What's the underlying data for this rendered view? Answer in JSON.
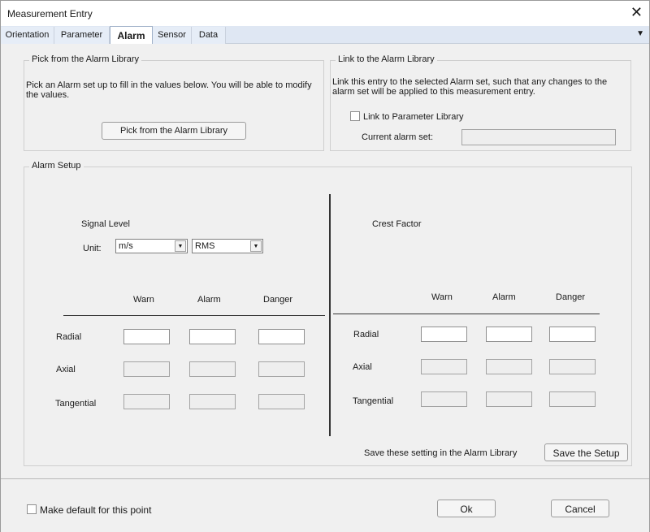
{
  "window": {
    "title": "Measurement Entry"
  },
  "tabs": [
    {
      "label": "Orientation"
    },
    {
      "label": "Parameter"
    },
    {
      "label": "Alarm"
    },
    {
      "label": "Sensor"
    },
    {
      "label": "Data"
    }
  ],
  "pick_group": {
    "caption": "Pick from the Alarm Library",
    "description": "Pick an Alarm set up to fill in the values below. You will be able to modify the values.",
    "button": "Pick from the Alarm Library"
  },
  "link_group": {
    "caption": "Link to the Alarm Library",
    "description": "Link this entry to the selected Alarm set, such that any changes to the alarm set will be applied to this measurement entry.",
    "checkbox_label": "Link to Parameter Library",
    "checkbox_checked": false,
    "current_label": "Current alarm set:",
    "current_value": ""
  },
  "setup_group": {
    "caption": "Alarm Setup",
    "signal": {
      "title": "Signal Level",
      "unit_label": "Unit:",
      "unit_value": "m/s",
      "type_value": "RMS",
      "cols": [
        "Warn",
        "Alarm",
        "Danger"
      ],
      "rows": [
        {
          "label": "Radial",
          "values": [
            "",
            "",
            ""
          ],
          "editable": true
        },
        {
          "label": "Axial",
          "values": [
            "",
            "",
            ""
          ],
          "editable": false
        },
        {
          "label": "Tangential",
          "values": [
            "",
            "",
            ""
          ],
          "editable": false
        }
      ]
    },
    "crest": {
      "title": "Crest Factor",
      "cols": [
        "Warn",
        "Alarm",
        "Danger"
      ],
      "rows": [
        {
          "label": "Radial",
          "values": [
            "",
            "",
            ""
          ],
          "editable": true
        },
        {
          "label": "Axial",
          "values": [
            "",
            "",
            ""
          ],
          "editable": false
        },
        {
          "label": "Tangential",
          "values": [
            "",
            "",
            ""
          ],
          "editable": false
        }
      ]
    },
    "save_text": "Save these setting in the Alarm Library",
    "save_button": "Save the Setup"
  },
  "footer": {
    "default_label": "Make default for this point",
    "default_checked": false,
    "ok": "Ok",
    "cancel": "Cancel"
  }
}
